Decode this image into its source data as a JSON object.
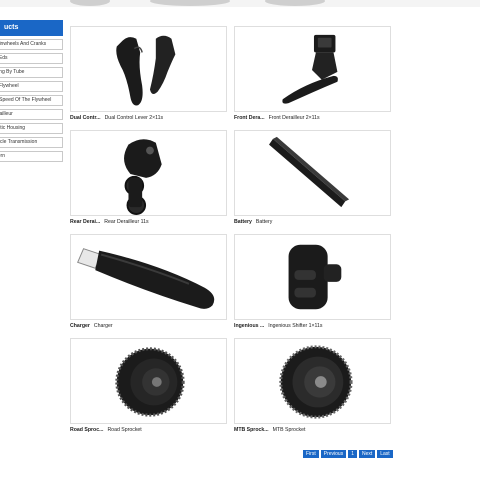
{
  "sidebar": {
    "heading": "ucts",
    "items": [
      "rainwheels And Cranks",
      "c Eds",
      "rting By Tube",
      "c Flywheel",
      "7 Speed Of The Flywheel",
      "erailleur",
      "astic Housing",
      "cycle Transmission",
      "ttern"
    ]
  },
  "products": [
    {
      "short": "Dual Contr...",
      "full": "Dual Control Lever 2×11s",
      "image": "dual-control-lever"
    },
    {
      "short": "Front Dera...",
      "full": "Front Derailleur 2×11s",
      "image": "front-derailleur"
    },
    {
      "short": "Rear Derai...",
      "full": "Rear Derailleur 11s",
      "image": "rear-derailleur"
    },
    {
      "short": "Battery",
      "full": "Battery",
      "image": "battery"
    },
    {
      "short": "Charger",
      "full": "Charger",
      "image": "usb-charger"
    },
    {
      "short": "Ingenious ...",
      "full": "Ingenious Shifter 1×11s",
      "image": "shifter"
    },
    {
      "short": "Road Sproc...",
      "full": "Road Sprocket",
      "image": "cassette"
    },
    {
      "short": "MTB Sprock...",
      "full": "MTB Sprocket",
      "image": "cassette"
    }
  ],
  "pager": {
    "first": "First",
    "previous": "Previous",
    "page": "1",
    "next": "Next",
    "last": "Last"
  },
  "colors": {
    "accent": "#1a67c6",
    "product_dark": "#1b1b1b"
  }
}
